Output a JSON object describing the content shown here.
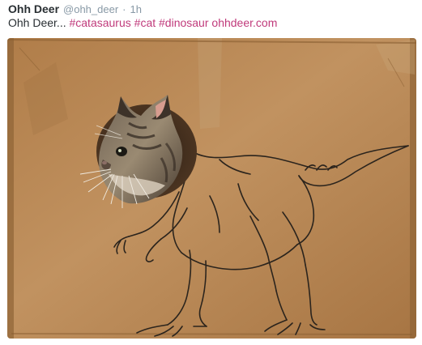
{
  "tweet": {
    "display_name": "Ohh Deer",
    "handle": "@ohh_deer",
    "separator": "·",
    "timestamp": "1h",
    "text_prefix": "Ohh Deer...",
    "hashtags": [
      "#catasaurus",
      "#cat",
      "#dinosaur"
    ],
    "link_text": "ohhdeer.com"
  },
  "colors": {
    "link": "#c03a7b",
    "name": "#292f33",
    "meta": "#8899a6",
    "cardboard": "#b98a55"
  },
  "photo": {
    "subject_icons": [
      "cardboard-box",
      "cat-head",
      "dinosaur-drawing"
    ]
  }
}
